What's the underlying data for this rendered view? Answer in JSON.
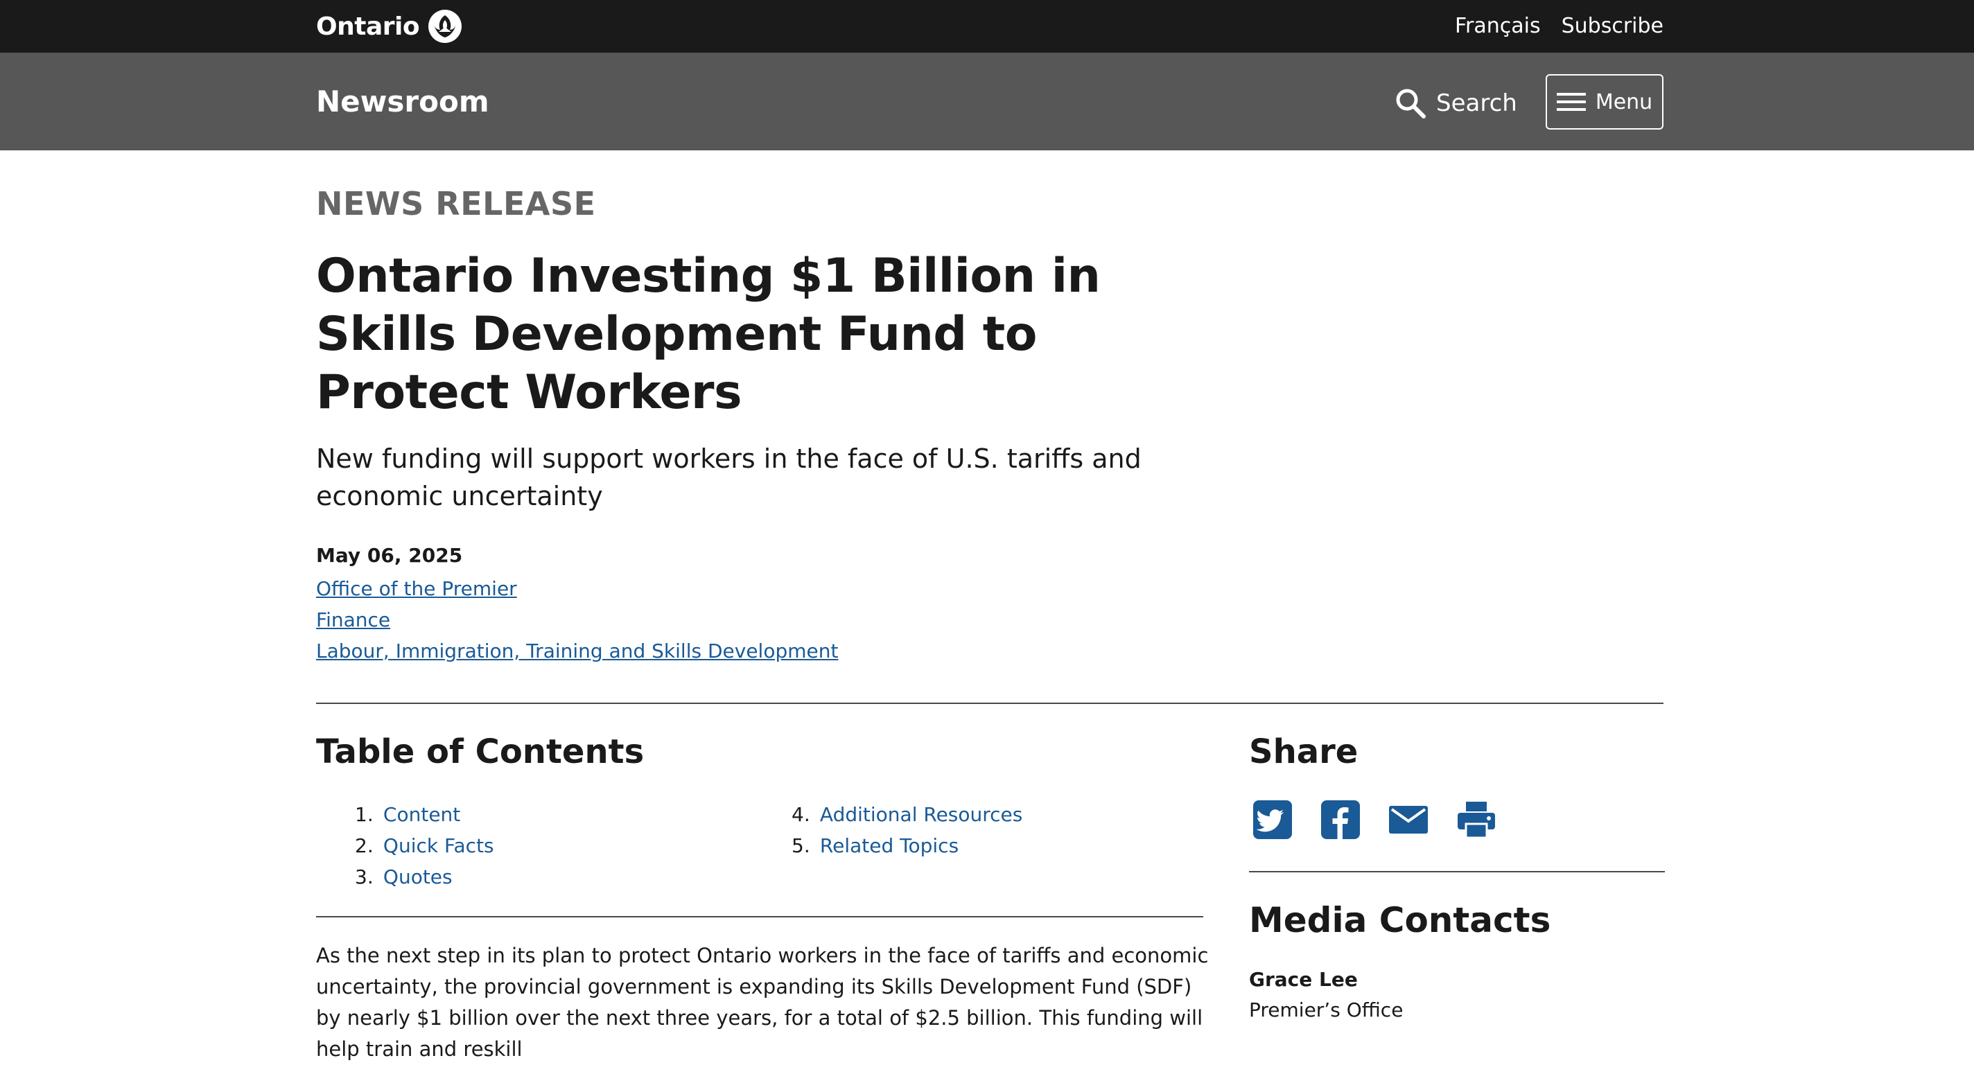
{
  "header": {
    "brand": "Ontario",
    "links": [
      "Français",
      "Subscribe"
    ]
  },
  "subheader": {
    "title": "Newsroom",
    "search_label": "Search",
    "menu_label": "Menu"
  },
  "article": {
    "eyebrow": "NEWS RELEASE",
    "title": "Ontario Investing $1 Billion in Skills Development Fund to Protect Workers",
    "subtitle": "New funding will support workers in the face of U.S. tariffs and economic uncertainty",
    "date": "May 06, 2025",
    "ministries": [
      "Office of the Premier",
      "Finance",
      "Labour, Immigration, Training and Skills Development"
    ],
    "body": "As the next step in its plan to protect Ontario workers in the face of tariffs and economic uncertainty, the provincial government is expanding its Skills Development Fund (SDF) by nearly $1 billion over the next three years, for a total of $2.5 billion. This funding will help train and reskill"
  },
  "toc": {
    "heading": "Table of Contents",
    "items": [
      {
        "num": "1.",
        "label": "Content"
      },
      {
        "num": "2.",
        "label": "Quick Facts"
      },
      {
        "num": "3.",
        "label": "Quotes"
      },
      {
        "num": "4.",
        "label": "Additional Resources"
      },
      {
        "num": "5.",
        "label": "Related Topics"
      }
    ]
  },
  "share": {
    "heading": "Share",
    "icons": [
      "twitter-icon",
      "facebook-icon",
      "email-icon",
      "print-icon"
    ],
    "icon_color": "#1a5a96"
  },
  "media": {
    "heading": "Media Contacts",
    "contact_name": "Grace Lee",
    "contact_office": "Premier’s Office"
  },
  "colors": {
    "topbar": "#1a1a1a",
    "subbar": "#575757",
    "link": "#1a5a96"
  }
}
